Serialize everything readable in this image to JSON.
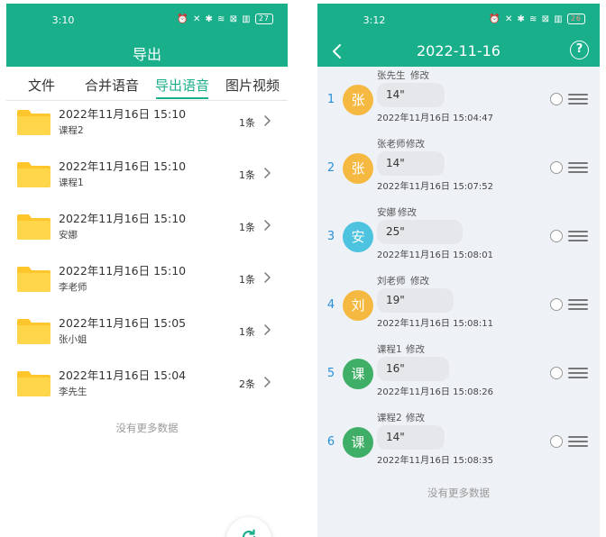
{
  "left": {
    "status": {
      "time": "3:10",
      "icons": "⏰ ✕ ✱ ≋ ⊠ ▥",
      "battery": "27"
    },
    "title": "导出",
    "tabs": [
      {
        "label": "文件",
        "active": false
      },
      {
        "label": "合并语音",
        "active": false
      },
      {
        "label": "导出语音",
        "active": true
      },
      {
        "label": "图片视频",
        "active": false
      }
    ],
    "folders": [
      {
        "date": "2022年11月16日 15:10",
        "name": "课程2",
        "count": "1条"
      },
      {
        "date": "2022年11月16日 15:10",
        "name": "课程1",
        "count": "1条"
      },
      {
        "date": "2022年11月16日 15:10",
        "name": "安娜",
        "count": "1条"
      },
      {
        "date": "2022年11月16日 15:10",
        "name": "李老师",
        "count": "1条"
      },
      {
        "date": "2022年11月16日 15:05",
        "name": "张小姐",
        "count": "1条"
      },
      {
        "date": "2022年11月16日 15:04",
        "name": "李先生",
        "count": "2条"
      }
    ],
    "no_more": "没有更多数据"
  },
  "right": {
    "status": {
      "time": "3:12",
      "icons": "⏰ ✕ ✱ ≋ ⊠ ▥",
      "battery": "26"
    },
    "title": "2022-11-16",
    "help": "?",
    "messages": [
      {
        "index": "1",
        "sender": "张先生",
        "edit": "修改",
        "avatar": "张",
        "avatar_color": "#f5b942",
        "duration": "14\"",
        "time": "2022年11月16日 15:04:47"
      },
      {
        "index": "2",
        "sender": "张老师",
        "edit": "修改",
        "avatar": "张",
        "avatar_color": "#f5b942",
        "duration": "14\"",
        "time": "2022年11月16日 15:07:52"
      },
      {
        "index": "3",
        "sender": "安娜",
        "edit": "修改",
        "avatar": "安",
        "avatar_color": "#4ec3e0",
        "duration": "25\"",
        "time": "2022年11月16日 15:08:01"
      },
      {
        "index": "4",
        "sender": "刘老师",
        "edit": "修改",
        "avatar": "刘",
        "avatar_color": "#f5b942",
        "duration": "19\"",
        "time": "2022年11月16日 15:08:11"
      },
      {
        "index": "5",
        "sender": "课程1",
        "edit": "修改",
        "avatar": "课",
        "avatar_color": "#3fae66",
        "duration": "16\"",
        "time": "2022年11月16日 15:08:26"
      },
      {
        "index": "6",
        "sender": "课程2",
        "edit": "修改",
        "avatar": "课",
        "avatar_color": "#3fae66",
        "duration": "14\"",
        "time": "2022年11月16日 15:08:35"
      }
    ],
    "no_more": "没有更多数据"
  },
  "colors": {
    "brand": "#1aaf8b",
    "folder": "#ffc62c",
    "index_blue": "#2a8fd6"
  }
}
